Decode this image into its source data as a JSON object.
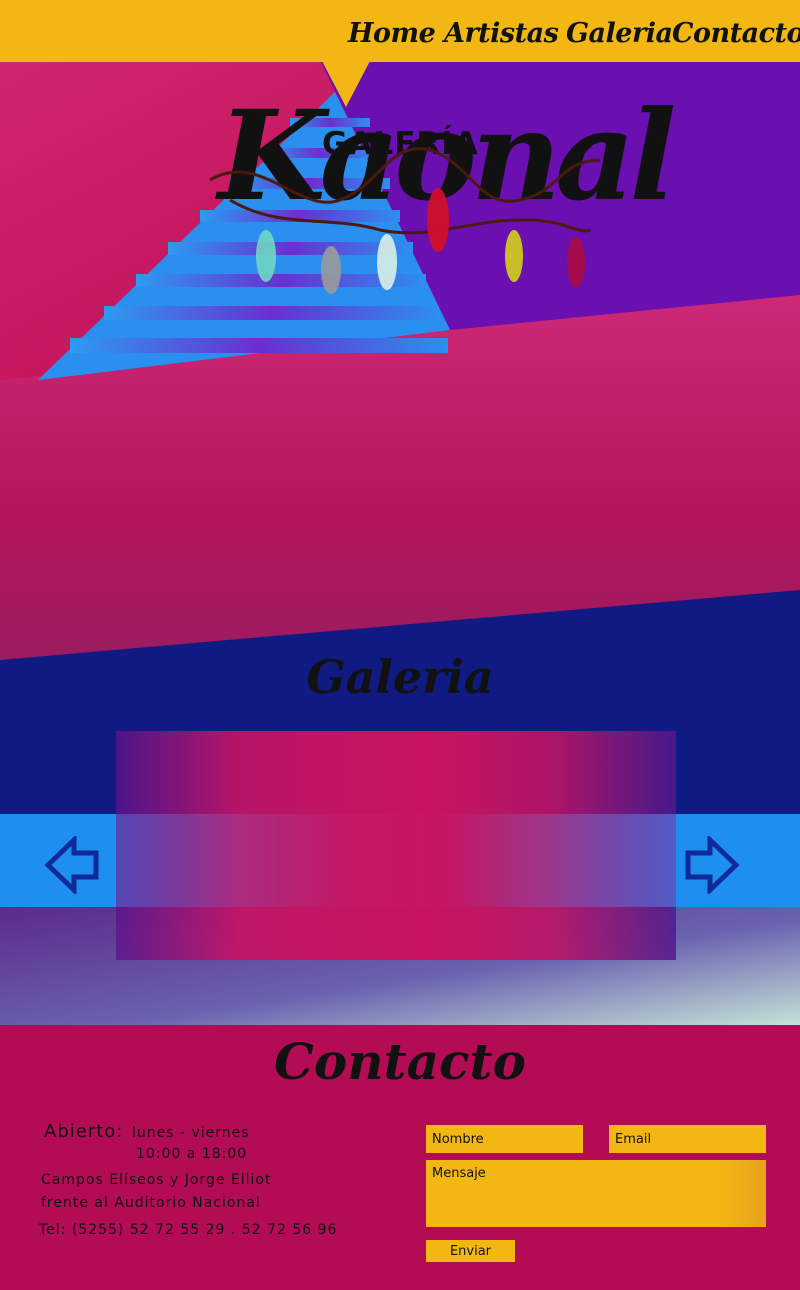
{
  "nav": {
    "home": "Home",
    "artistas": "Artistas",
    "galeria": "Galeria",
    "contacto": "Contacto"
  },
  "logo": {
    "small": "GALERÍA",
    "big": "Kaonal"
  },
  "gallery": {
    "title": "Galeria",
    "prev_icon": "arrow-left-icon",
    "next_icon": "arrow-right-icon"
  },
  "contact": {
    "title": "Contacto",
    "hours_label": "Abierto:",
    "days": "lunes - viernes",
    "time": "10:00 a 18:00",
    "address_line1": "Campos Elíseos y Jorge Elliot",
    "address_line2": "frente al Auditorio Nacional",
    "phone": "Tel: (5255) 52 72 55 29 . 52 72 56 96",
    "form": {
      "name_placeholder": "Nombre",
      "email_placeholder": "Email",
      "message_placeholder": "Mensaje",
      "send_label": "Enviar"
    }
  },
  "colors": {
    "yellow": "#f3b714",
    "magenta": "#c8145e",
    "purple": "#6a0fb0",
    "navy": "#0f1a82",
    "sky": "#1e8ef0"
  }
}
